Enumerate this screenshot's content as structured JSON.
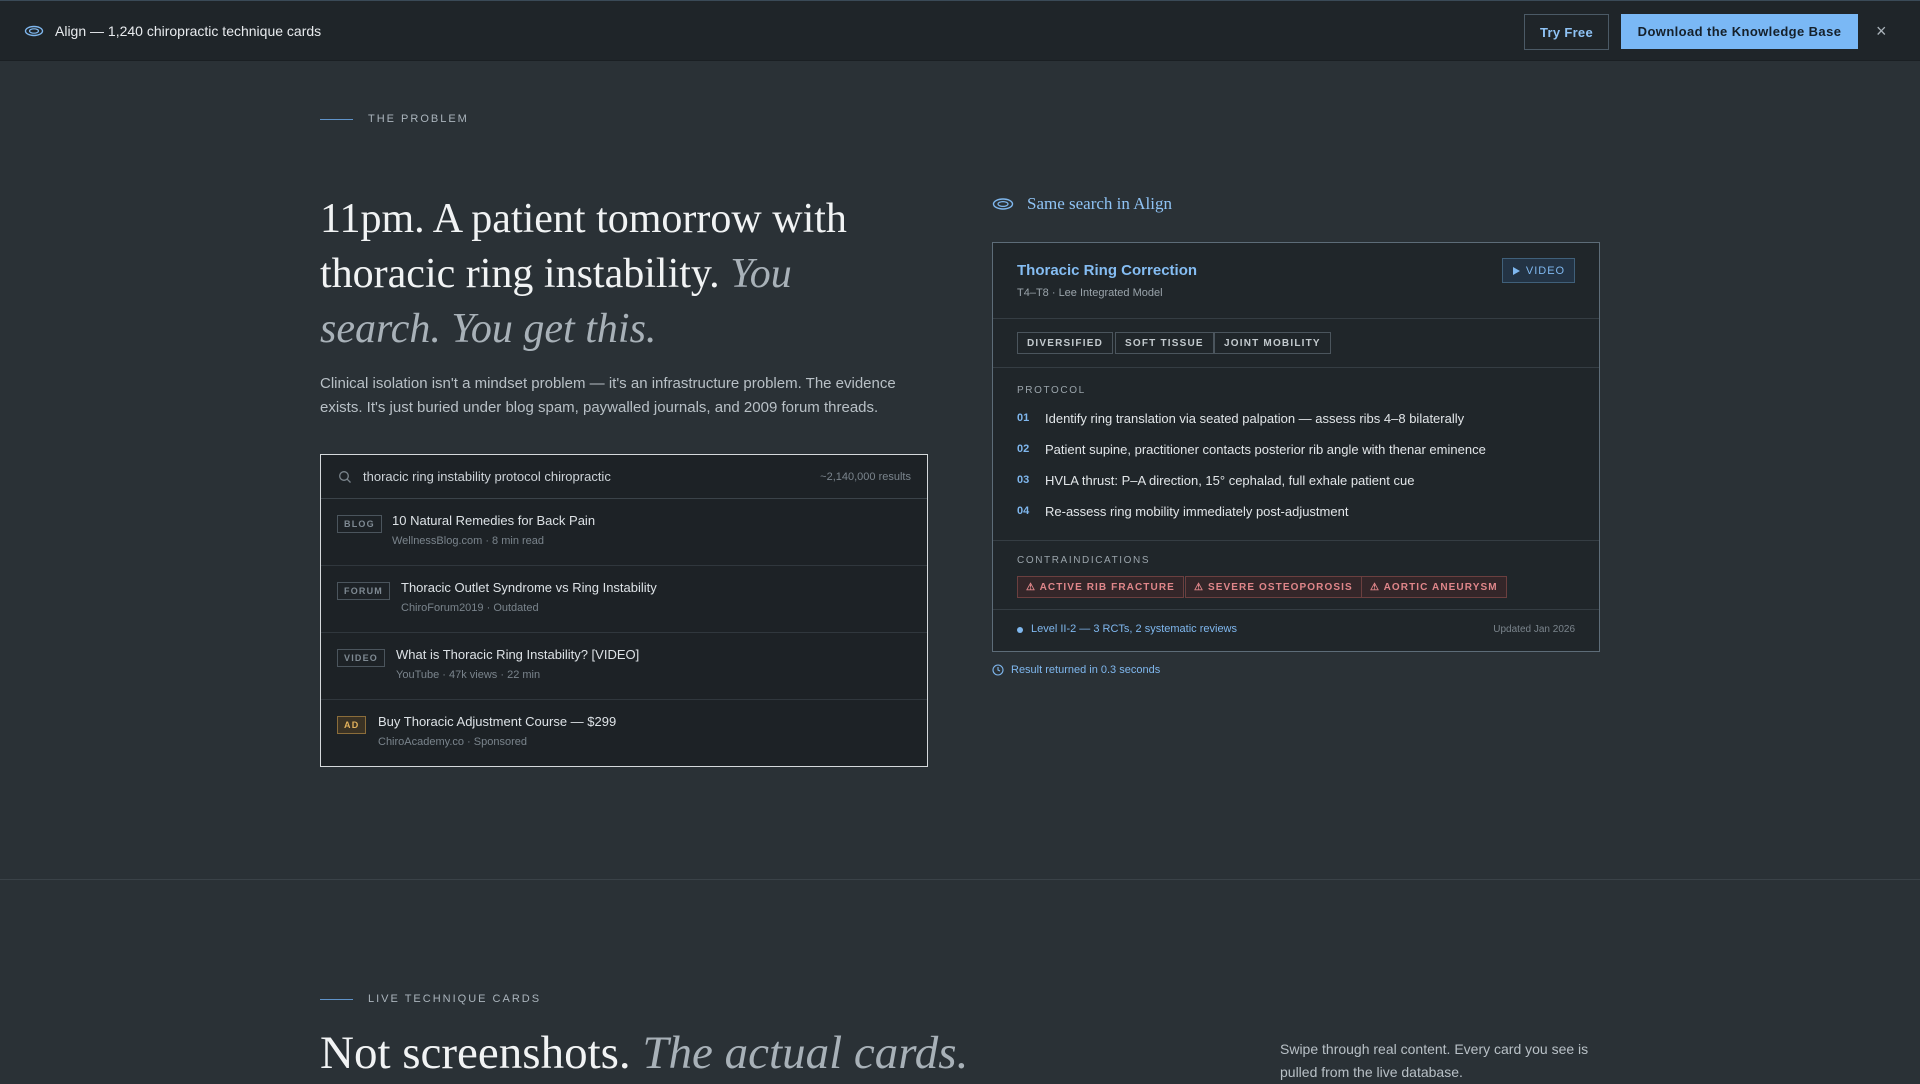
{
  "topbar": {
    "brand_icon": "eye-icon",
    "title": "Align — 1,240 chiropractic technique cards",
    "try_label": "Try Free",
    "download_label": "Download the Knowledge Base",
    "close_label": "×"
  },
  "problem": {
    "eyebrow": "THE PROBLEM",
    "headline_plain": "11pm. A patient tomorrow with thoracic ring instability. ",
    "headline_italic": "You search. You get this.",
    "lede": "Clinical isolation isn't a mindset problem — it's an infrastructure problem. The evidence exists. It's just buried under blog spam, paywalled journals, and 2009 forum threads."
  },
  "search": {
    "query": "thoracic ring instability protocol chiropractic",
    "count": "~2,140,000 results",
    "results": [
      {
        "tag": "BLOG",
        "title": "10 Natural Remedies for Back Pain",
        "meta": "WellnessBlog.com · 8 min read"
      },
      {
        "tag": "FORUM",
        "title": "Thoracic Outlet Syndrome vs Ring Instability",
        "meta": "ChiroForum2019 · Outdated"
      },
      {
        "tag": "VIDEO",
        "title": "What is Thoracic Ring Instability? [VIDEO]",
        "meta": "YouTube · 47k views · 22 min"
      },
      {
        "tag": "AD",
        "title": "Buy Thoracic Adjustment Course — $299",
        "meta": "ChiroAcademy.co · Sponsored"
      }
    ]
  },
  "align": {
    "heading": "Same search in Align",
    "card": {
      "title": "Thoracic Ring Correction",
      "subtitle": "T4–T8 · Lee Integrated Model",
      "video_label": "VIDEO",
      "tags": [
        "DIVERSIFIED",
        "SOFT TISSUE",
        "JOINT MOBILITY"
      ],
      "protocol_label": "PROTOCOL",
      "steps": [
        {
          "num": "01",
          "text": "Identify ring translation via seated palpation — assess ribs 4–8 bilaterally"
        },
        {
          "num": "02",
          "text": "Patient supine, practitioner contacts posterior rib angle with thenar eminence"
        },
        {
          "num": "03",
          "text": "HVLA thrust: P–A direction, 15° cephalad, full exhale patient cue"
        },
        {
          "num": "04",
          "text": "Re-assess ring mobility immediately post-adjustment"
        }
      ],
      "contra_label": "CONTRAINDICATIONS",
      "contraindications": [
        "⚠ ACTIVE RIB FRACTURE",
        "⚠ SEVERE OSTEOPOROSIS",
        "⚠ AORTIC ANEURYSM"
      ],
      "evidence": "Level II-2 — 3 RCTs, 2 systematic reviews",
      "updated": "Updated Jan 2026"
    },
    "returned": "Result returned in 0.3 seconds"
  },
  "live": {
    "eyebrow": "LIVE TECHNIQUE CARDS",
    "headline_plain": "Not screenshots. ",
    "headline_italic": "The actual cards.",
    "swipe_text": "Swipe through real content. Every card you see is pulled from the live database."
  },
  "colors": {
    "background": "#2a3136",
    "topbar": "#1f2529",
    "accent": "#7ab8f5",
    "warning": "#e0868a",
    "ad": "#e3b25c"
  }
}
